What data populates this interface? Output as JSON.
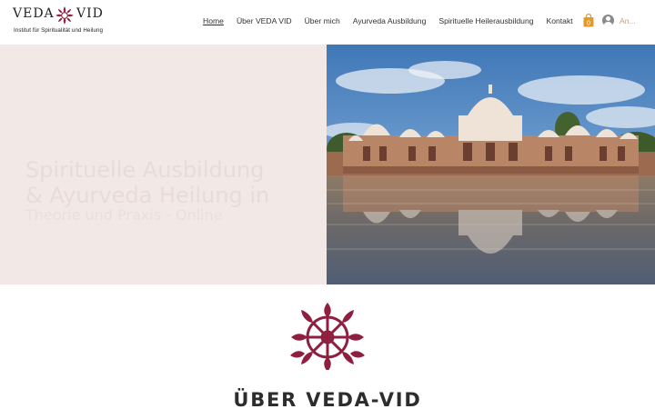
{
  "brand": {
    "name_left": "VEDA",
    "name_right": "VID",
    "tagline": "Institut für Spiritualität und Heilung",
    "accent_color": "#8e1f3f"
  },
  "nav": {
    "items": [
      {
        "label": "Home",
        "active": true
      },
      {
        "label": "Über VEDA VID",
        "active": false
      },
      {
        "label": "Über mich",
        "active": false
      },
      {
        "label": "Ayurveda Ausbildung",
        "active": false
      },
      {
        "label": "Spirituelle Heilerausbildung",
        "active": false
      },
      {
        "label": "Kontakt",
        "active": false
      }
    ]
  },
  "cart": {
    "count": "0",
    "icon": "shopping-bag-icon",
    "color": "#e39a2d"
  },
  "login": {
    "label": "An...",
    "icon": "user-avatar-icon"
  },
  "hero": {
    "line1": "Spirituelle Ausbildung",
    "line2": "& Ayurveda Heilung in",
    "line3": "Theorie und Praxis - Online",
    "background": "#f2e8e5",
    "image_alt": "Indian temple palace reflected in a lake"
  },
  "about": {
    "title": "ÜBER VEDA-VID",
    "icon": "dharma-wheel-icon"
  }
}
